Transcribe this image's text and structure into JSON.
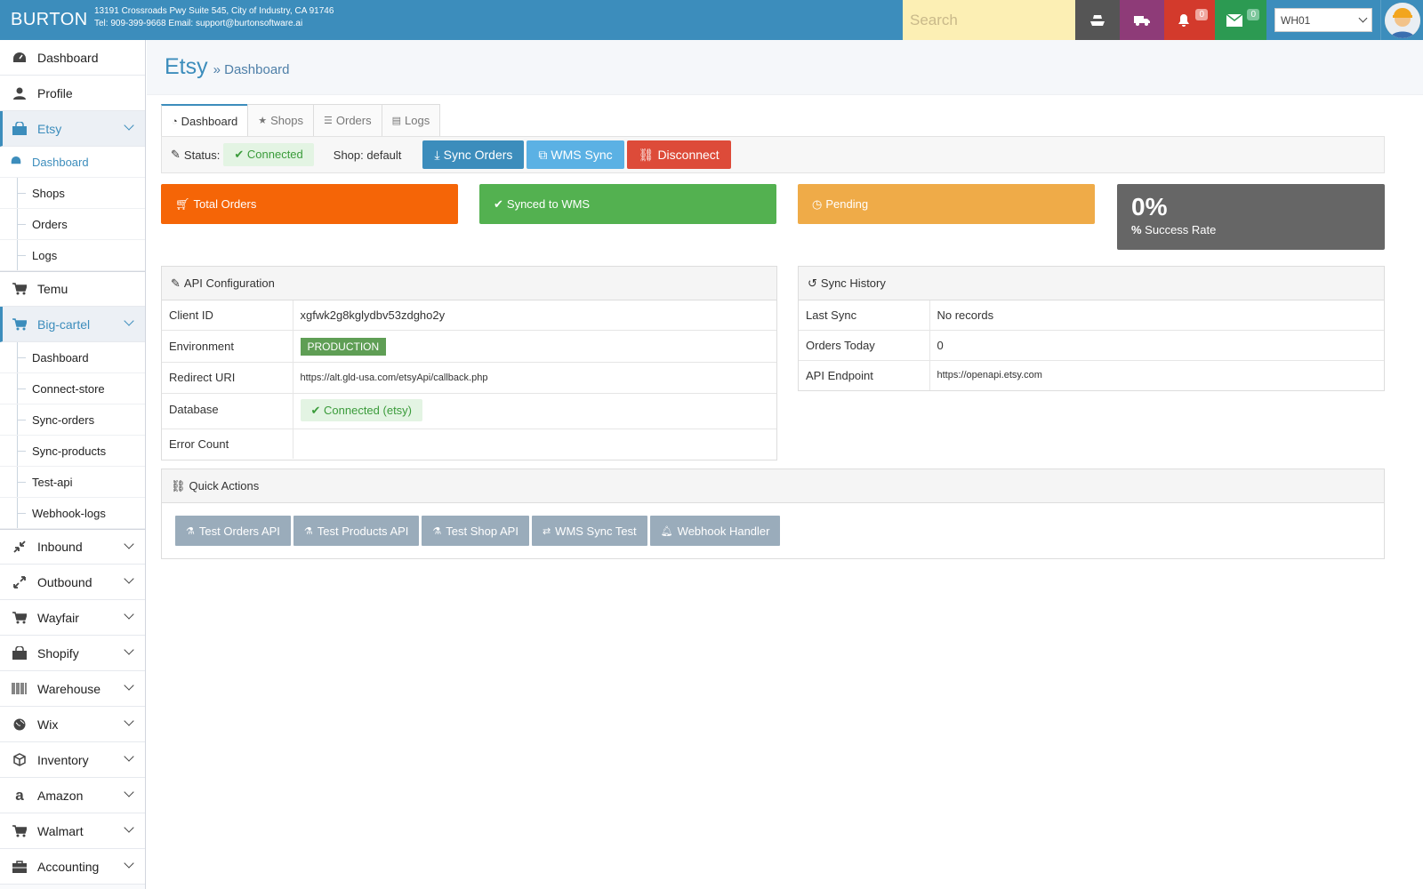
{
  "topbar": {
    "brand": "BURTON",
    "address_line1": "13191 Crossroads Pwy Suite 545, City of Industry, CA 91746",
    "address_line2": "Tel: 909-399-9668 Email: support@burtonsoftware.ai",
    "search_placeholder": "Search",
    "notifications_count": "0",
    "messages_count": "0",
    "warehouse": "WH01",
    "colors": {
      "bar": "#3c8dbc",
      "search": "#fcefb4",
      "bell": "#d33a2c",
      "mail": "#2c9a52",
      "truck": "#8e3b78"
    }
  },
  "sidebar": {
    "items": [
      {
        "label": "Dashboard",
        "icon": "dashboard-icon"
      },
      {
        "label": "Profile",
        "icon": "user-icon"
      },
      {
        "label": "Etsy",
        "icon": "shopping-bag-icon",
        "expanded": true,
        "children": [
          "Dashboard",
          "Shops",
          "Orders",
          "Logs"
        ],
        "active_child": "Dashboard"
      },
      {
        "label": "Temu",
        "icon": "cart-icon"
      },
      {
        "label": "Big-cartel",
        "icon": "cart-icon",
        "expanded": true,
        "children": [
          "Dashboard",
          "Connect-store",
          "Sync-orders",
          "Sync-products",
          "Test-api",
          "Webhook-logs"
        ]
      },
      {
        "label": "Inbound",
        "icon": "compress-icon"
      },
      {
        "label": "Outbound",
        "icon": "expand-icon"
      },
      {
        "label": "Wayfair",
        "icon": "cart-icon"
      },
      {
        "label": "Shopify",
        "icon": "shopping-bag-icon"
      },
      {
        "label": "Warehouse",
        "icon": "barcode-icon"
      },
      {
        "label": "Wix",
        "icon": "globe-icon"
      },
      {
        "label": "Inventory",
        "icon": "cube-icon"
      },
      {
        "label": "Amazon",
        "icon": "amazon-icon"
      },
      {
        "label": "Walmart",
        "icon": "cart-icon"
      },
      {
        "label": "Accounting",
        "icon": "briefcase-icon"
      }
    ]
  },
  "header": {
    "title": "Etsy",
    "breadcrumb": "» Dashboard"
  },
  "tabs": [
    {
      "label": "Dashboard",
      "icon": "dashboard-icon",
      "active": true
    },
    {
      "label": "Shops",
      "icon": "star-icon"
    },
    {
      "label": "Orders",
      "icon": "list-icon"
    },
    {
      "label": "Logs",
      "icon": "file-icon"
    }
  ],
  "status": {
    "label": "Status:",
    "value": "Connected",
    "shop": "Shop: default",
    "sync_orders": "Sync Orders",
    "wms_sync": "WMS Sync",
    "disconnect": "Disconnect"
  },
  "stats": {
    "total_orders": "Total Orders",
    "synced": "Synced to WMS",
    "pending": "Pending",
    "success_rate_value": "0%",
    "success_rate_label": "Success Rate"
  },
  "api_config": {
    "title": "API Configuration",
    "rows": [
      {
        "k": "Client ID",
        "v": "xgfwk2g8kglydbv53zdgho2y"
      },
      {
        "k": "Environment",
        "v": "PRODUCTION"
      },
      {
        "k": "Redirect URI",
        "v": "https://alt.gld-usa.com/etsyApi/callback.php"
      },
      {
        "k": "Database",
        "v": "Connected (etsy)"
      },
      {
        "k": "Error Count",
        "v": ""
      }
    ]
  },
  "sync_history": {
    "title": "Sync History",
    "rows": [
      {
        "k": "Last Sync",
        "v": "No records"
      },
      {
        "k": "Orders Today",
        "v": "0"
      },
      {
        "k": "API Endpoint",
        "v": "https://openapi.etsy.com"
      }
    ]
  },
  "quick_actions": {
    "title": "Quick Actions",
    "buttons": [
      "Test Orders API",
      "Test Products API",
      "Test Shop API",
      "WMS Sync Test",
      "Webhook Handler"
    ]
  }
}
